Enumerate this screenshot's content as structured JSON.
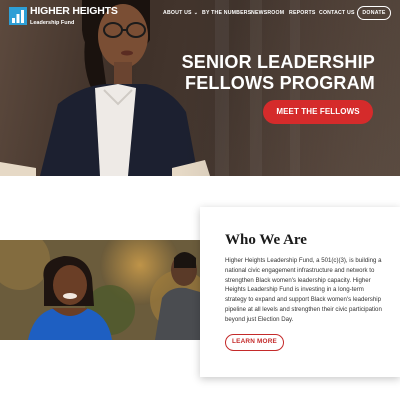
{
  "brand": {
    "line1": "HIGHER",
    "line2": "HEIGHTS",
    "line3": "Leadership Fund",
    "accent_color": "#2e9fd6"
  },
  "nav": {
    "items": [
      {
        "label": "ABOUT US",
        "has_dropdown": true
      },
      {
        "label": "BY THE NUMBERS"
      },
      {
        "label": "NEWSROOM"
      },
      {
        "label": "REPORTS"
      },
      {
        "label": "CONTACT US"
      }
    ],
    "donate_label": "DONATE"
  },
  "hero": {
    "title_line1": "SENIOR LEADERSHIP",
    "title_line2": "FELLOWS PROGRAM",
    "cta_label": "MEET THE FELLOWS",
    "cta_color": "#d52b2b"
  },
  "about": {
    "title": "Who We Are",
    "body": "Higher Heights Leadership Fund, a 501(c)(3), is building a national civic engagement infrastructure and network to strengthen Black women's leadership capacity. Higher Heights Leadership Fund is investing in a long-term strategy to expand and support Black women's leadership pipeline at all levels and strengthen their civic participation beyond just Election Day.",
    "button_label": "LEARN MORE",
    "button_color": "#c42a2a"
  },
  "icons": {
    "logo": "logo-icon",
    "dropdown": "chevron-down-icon"
  }
}
